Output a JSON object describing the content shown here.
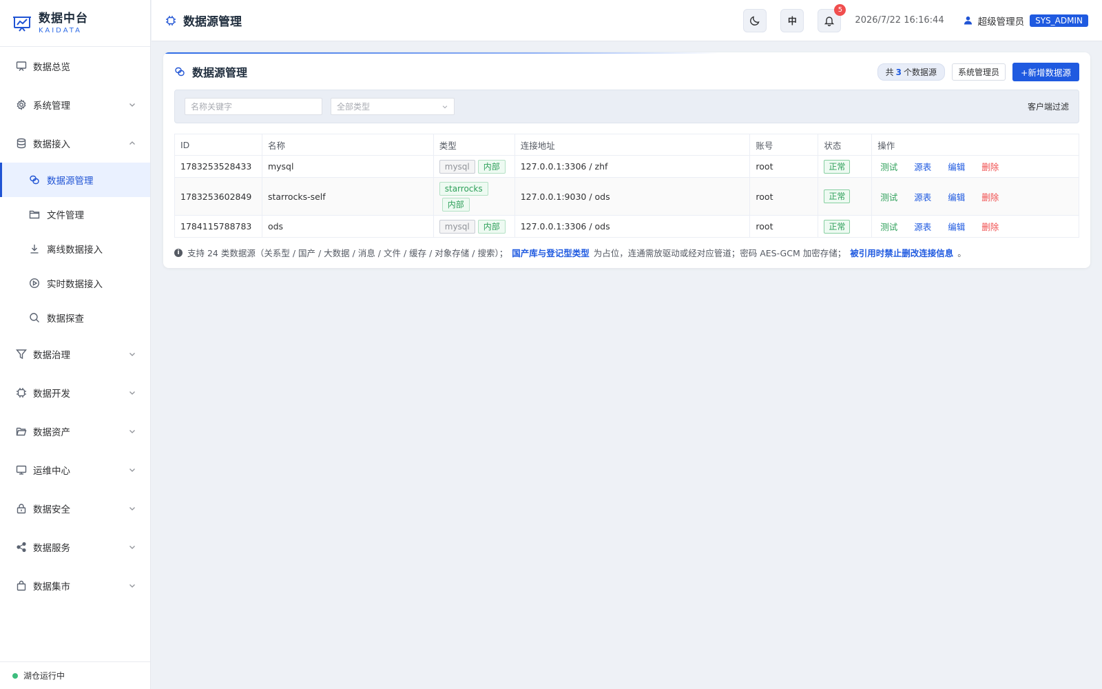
{
  "app": {
    "title": "数据中台",
    "subtitle": "KAIDATA",
    "status_text": "湖仓运行中"
  },
  "sidebar": {
    "items": [
      {
        "label": "数据总览",
        "icon": "monitor-icon"
      },
      {
        "label": "系统管理",
        "icon": "gear-icon"
      },
      {
        "label": "数据接入",
        "icon": "database-icon"
      },
      {
        "label": "数据治理",
        "icon": "filter-icon"
      },
      {
        "label": "数据开发",
        "icon": "chip-icon"
      },
      {
        "label": "数据资产",
        "icon": "folder-open-icon"
      },
      {
        "label": "运维中心",
        "icon": "desktop-icon"
      },
      {
        "label": "数据安全",
        "icon": "lock-icon"
      },
      {
        "label": "数据服务",
        "icon": "share-icon"
      },
      {
        "label": "数据集市",
        "icon": "shopping-bag-icon"
      }
    ],
    "sub_items": [
      {
        "label": "数据源管理",
        "icon": "link-icon"
      },
      {
        "label": "文件管理",
        "icon": "folder-icon"
      },
      {
        "label": "离线数据接入",
        "icon": "download-icon"
      },
      {
        "label": "实时数据接入",
        "icon": "play-circle-icon"
      },
      {
        "label": "数据探查",
        "icon": "search-icon"
      }
    ]
  },
  "header": {
    "title": "数据源管理",
    "lang_label": "中",
    "notification_count": "5",
    "datetime": "2026/7/22 16:16:44",
    "user_name": "超级管理员",
    "user_role": "SYS_ADMIN"
  },
  "card": {
    "title": "数据源管理",
    "count_prefix": "共",
    "count_value": "3",
    "count_suffix": "个数据源",
    "role_button": "系统管理员",
    "add_button": "+新增数据源"
  },
  "filter": {
    "keyword_placeholder": "名称关键字",
    "type_select": "全部类型",
    "client_filter": "客户端过滤"
  },
  "table": {
    "headers": [
      "ID",
      "名称",
      "类型",
      "连接地址",
      "账号",
      "状态",
      "操作"
    ],
    "rows": [
      {
        "id": "1783253528433",
        "name": "mysql",
        "type": "mysql",
        "scope": "内部",
        "address": "127.0.0.1:3306 / zhf",
        "account": "root",
        "status": "正常"
      },
      {
        "id": "1783253602849",
        "name": "starrocks-self",
        "type": "starrocks",
        "scope": "内部",
        "address": "127.0.0.1:9030 / ods",
        "account": "root",
        "status": "正常"
      },
      {
        "id": "1784115788783",
        "name": "ods",
        "type": "mysql",
        "scope": "内部",
        "address": "127.0.0.1:3306 / ods",
        "account": "root",
        "status": "正常"
      }
    ],
    "actions": {
      "test": "测试",
      "tables": "源表",
      "edit": "编辑",
      "delete": "删除"
    }
  },
  "note": {
    "text1": "支持 24 类数据源（关系型 / 国产 / 大数据 / 消息 / 文件 / 缓存 / 对象存储 / 搜索）；",
    "link1": "国产库与登记型类型",
    "text2": "为占位，连通需放驱动或经对应管道；密码 AES-GCM 加密存储；",
    "link2": "被引用时禁止删改连接信息",
    "text3": "。"
  },
  "colors": {
    "primary": "#1f5ae0",
    "success": "#2ea05a",
    "danger": "#f04e4e",
    "background": "#eef1f6"
  }
}
